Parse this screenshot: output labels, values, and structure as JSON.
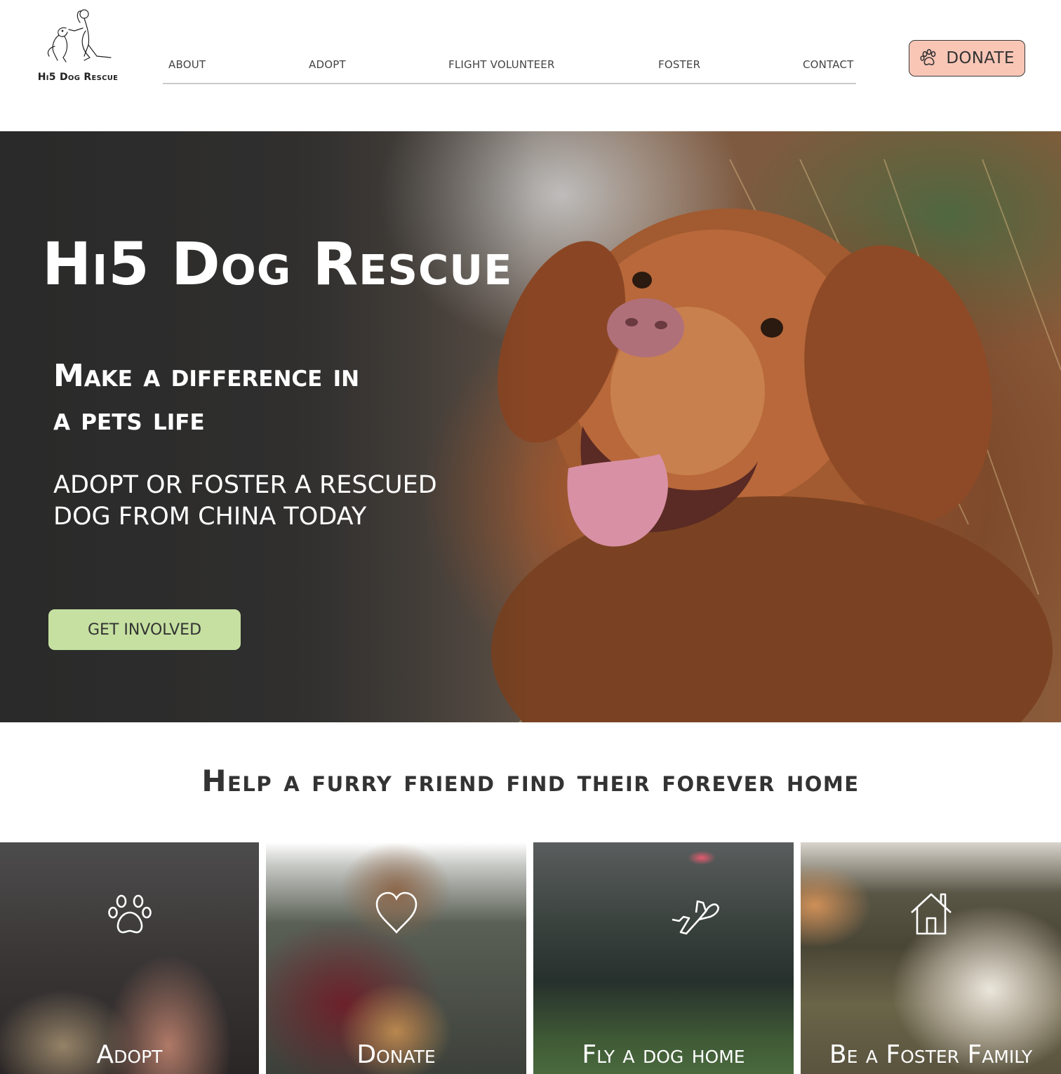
{
  "brand": {
    "name": "Hi5 Dog Rescue"
  },
  "nav": {
    "items": [
      "ABOUT",
      "ADOPT",
      "FLIGHT VOLUNTEER",
      "FOSTER",
      "CONTACT"
    ]
  },
  "donate_button": {
    "label": "DONATE",
    "icon": "paw-icon"
  },
  "hero": {
    "title": "Hi5 Dog Rescue",
    "subtitle_line1": "Make a difference in",
    "subtitle_line2": "a pets life",
    "text_line1": "ADOPT OR FOSTER A RESCUED",
    "text_line2": "DOG FROM CHINA TODAY",
    "cta_label": "GET INVOLVED"
  },
  "section": {
    "title": "Help a furry friend find their forever home"
  },
  "cards": [
    {
      "label": "Adopt",
      "icon": "paw-icon"
    },
    {
      "label": "Donate",
      "icon": "heart-icon"
    },
    {
      "label": "Fly a dog home",
      "icon": "airplane-icon"
    },
    {
      "label": "Be a Foster Family",
      "icon": "house-icon"
    }
  ],
  "colors": {
    "donate_bg": "#f9c6b6",
    "cta_bg": "#c5e0a0",
    "text_dark": "#333333"
  }
}
